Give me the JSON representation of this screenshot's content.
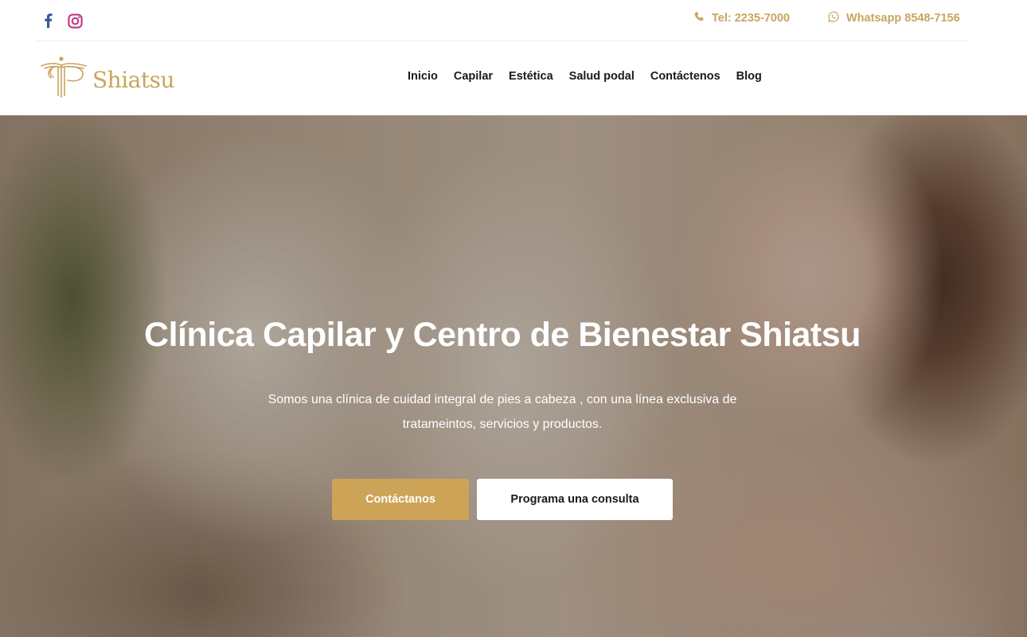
{
  "topbar": {
    "facebook_icon": "facebook-icon",
    "instagram_icon": "instagram-icon",
    "phone": {
      "icon": "phone-icon",
      "label": "Tel: 2235-7000"
    },
    "whatsapp": {
      "icon": "whatsapp-icon",
      "label": "Whatsapp 8548-7156"
    }
  },
  "header": {
    "logo": {
      "icon": "shiatsu-emblem-icon",
      "text": "Shiatsu"
    },
    "nav": [
      {
        "label": "Inicio"
      },
      {
        "label": "Capilar"
      },
      {
        "label": "Estética"
      },
      {
        "label": "Salud podal"
      },
      {
        "label": "Contáctenos"
      },
      {
        "label": "Blog"
      }
    ]
  },
  "hero": {
    "title": "Clínica Capilar y Centro de Bienestar Shiatsu",
    "subtitle": "Somos una clínica de cuidad integral de pies a cabeza , con una línea exclusiva de tratameintos, servicios y productos.",
    "primary_button": "Contáctanos",
    "secondary_button": "Programa una consulta"
  },
  "colors": {
    "accent": "#c9a55d",
    "button_gold": "#cda457",
    "facebook": "#3b5998",
    "instagram": "#c13584",
    "text_dark": "#1a1a1a"
  }
}
